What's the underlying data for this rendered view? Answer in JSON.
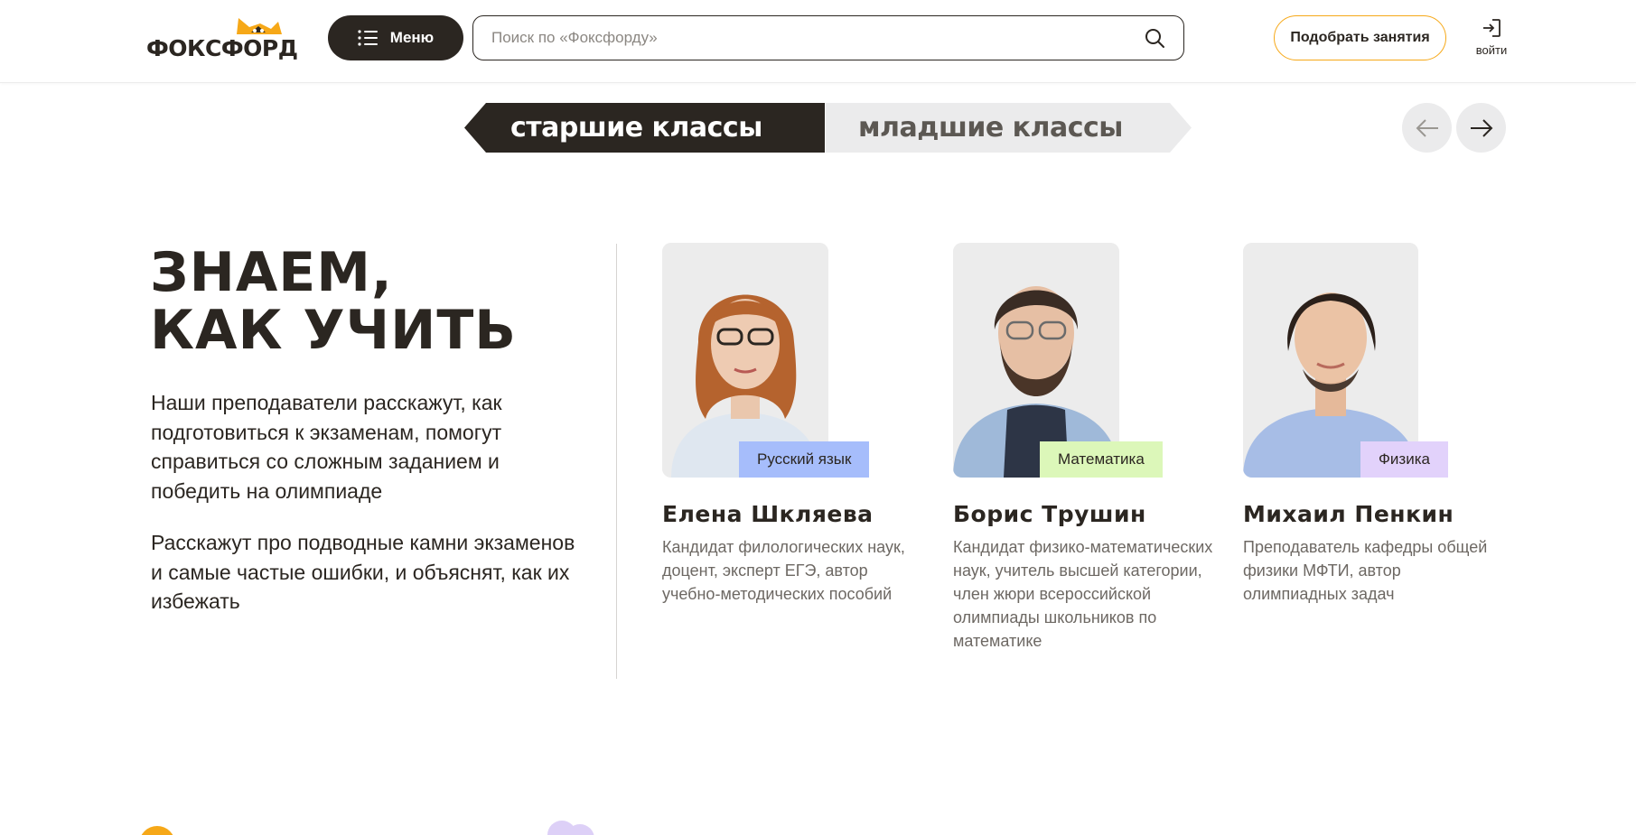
{
  "header": {
    "logo_text": "ФОКСФОРД",
    "menu_label": "Меню",
    "search_placeholder": "Поиск по «Фоксфорду»",
    "pick_label": "Подобрать занятия",
    "login_label": "войти"
  },
  "tabs": [
    {
      "label": "старшие классы",
      "active": true
    },
    {
      "label": "младшие классы",
      "active": false
    }
  ],
  "intro": {
    "heading_line1": "ЗНАЕМ,",
    "heading_line2": "КАК УЧИТЬ",
    "para1": "Наши преподаватели расскажут, как подготовиться к экзаменам, помогут справиться со сложным заданием и победить на олимпиаде",
    "para2": "Расскажут про подводные камни экзаменов и самые частые ошибки, и объяснят, как их избежать"
  },
  "teachers": [
    {
      "name": "Елена Шкляева",
      "subject": "Русский язык",
      "subject_color": "#a6bdfb",
      "description": "Кандидат филологических наук, доцент, эксперт ЕГЭ, автор учебно-методических пособий"
    },
    {
      "name": "Борис Трушин",
      "subject": "Математика",
      "subject_color": "#dcf7b9",
      "description": "Кандидат физико-математических наук, учитель высшей категории, член жюри всероссийской олимпиады школьников по математике"
    },
    {
      "name": "Михаил Пенкин",
      "subject": "Физика",
      "subject_color": "#e2d2fb",
      "description": "Преподаватель кафедры общей физики МФТИ, автор олимпиадных задач"
    }
  ],
  "colors": {
    "dark": "#2b2621",
    "accent_orange": "#f6a818",
    "tab_inactive_bg": "#ebebec"
  },
  "icons": [
    "list-icon",
    "search-icon",
    "login-icon",
    "arrow-left-icon",
    "arrow-right-icon",
    "fox-ears-icon"
  ]
}
